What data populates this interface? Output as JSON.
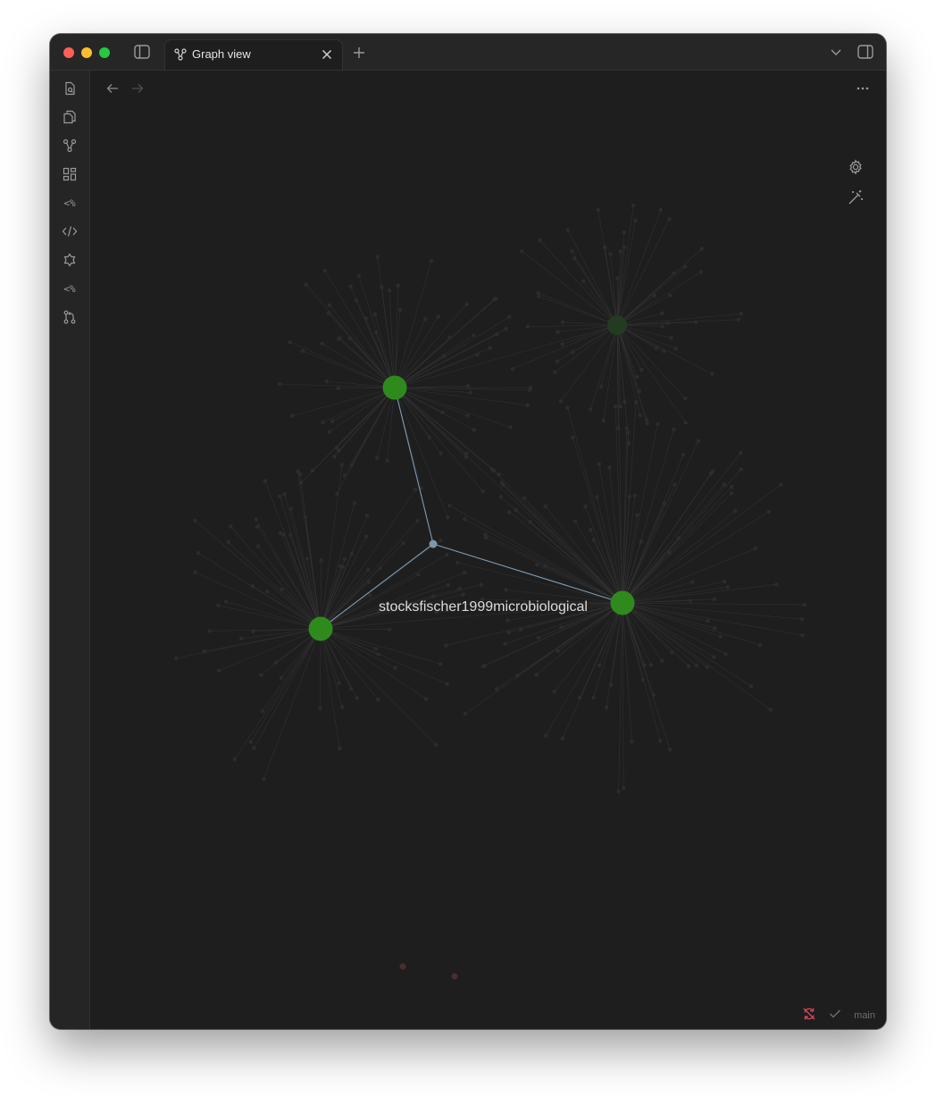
{
  "window": {
    "tab": {
      "title": "Graph view",
      "icon": "graph-icon"
    }
  },
  "ribbon": {
    "items": [
      {
        "name": "ribbon-search-file-icon",
        "icon": "file-search-icon"
      },
      {
        "name": "ribbon-files-icon",
        "icon": "files-icon"
      },
      {
        "name": "ribbon-graph-icon",
        "icon": "graph-icon"
      },
      {
        "name": "ribbon-canvas-icon",
        "icon": "layout-dashboard-icon"
      },
      {
        "name": "ribbon-template-icon",
        "icon": "template-icon",
        "text": "<%"
      },
      {
        "name": "ribbon-code-icon",
        "icon": "code-icon"
      },
      {
        "name": "ribbon-plugin-icon",
        "icon": "bot-icon"
      },
      {
        "name": "ribbon-template2-icon",
        "icon": "template-icon",
        "text": "<%"
      },
      {
        "name": "ribbon-git-icon",
        "icon": "git-pull-request-icon"
      }
    ]
  },
  "graph": {
    "focus_label": "stocksfischer1999microbiological",
    "colors": {
      "background": "#1e1e1e",
      "hub_node": "#2f8a1e",
      "dim_hub_node": "#233b20",
      "focus_node": "#7d96ad",
      "focus_edge": "#7e9bb5",
      "faded_edge": "#363636",
      "faded_node": "#2c2c2c",
      "orphan_node": "#4a2e2e"
    }
  },
  "status_bar": {
    "branch": "main",
    "sync_color": "#e0475b"
  }
}
